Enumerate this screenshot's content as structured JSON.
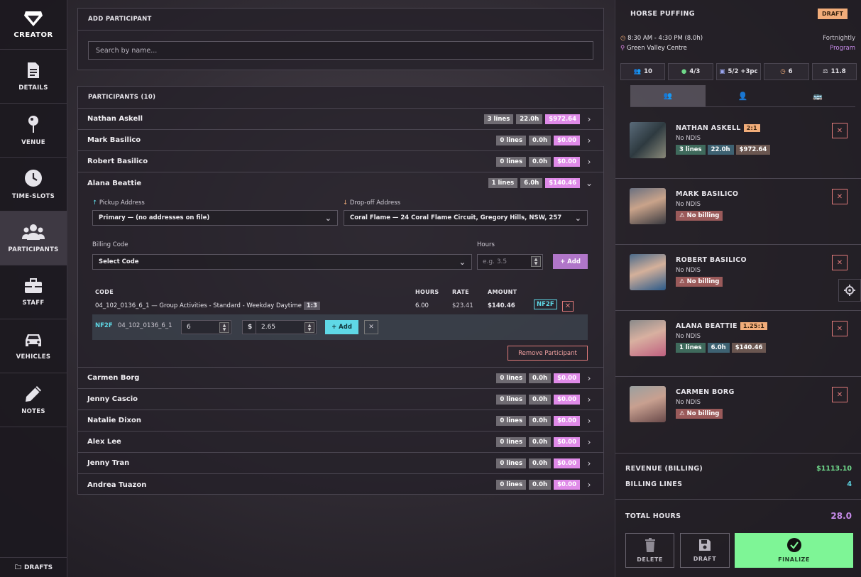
{
  "sidebar": {
    "brand": "CREATOR",
    "items": [
      {
        "label": "DETAILS",
        "icon": "document-icon"
      },
      {
        "label": "VENUE",
        "icon": "map-pin-icon"
      },
      {
        "label": "TIME-SLOTS",
        "icon": "clock-icon"
      },
      {
        "label": "PARTICIPANTS",
        "icon": "people-icon",
        "active": true
      },
      {
        "label": "STAFF",
        "icon": "briefcase-icon"
      },
      {
        "label": "VEHICLES",
        "icon": "car-icon"
      },
      {
        "label": "NOTES",
        "icon": "pencil-icon"
      }
    ],
    "drafts": "DRAFTS"
  },
  "add_participant": {
    "title": "ADD PARTICIPANT",
    "search_placeholder": "Search by name..."
  },
  "participants": {
    "title": "PARTICIPANTS (10)",
    "rows": [
      {
        "name": "Nathan Askell",
        "lines": "3 lines",
        "hours": "22.0h",
        "amount": "$972.64"
      },
      {
        "name": "Mark Basilico",
        "lines": "0 lines",
        "hours": "0.0h",
        "amount": "$0.00"
      },
      {
        "name": "Robert Basilico",
        "lines": "0 lines",
        "hours": "0.0h",
        "amount": "$0.00"
      },
      {
        "name": "Alana Beattie",
        "lines": "1 lines",
        "hours": "6.0h",
        "amount": "$140.46"
      },
      {
        "name": "Carmen Borg",
        "lines": "0 lines",
        "hours": "0.0h",
        "amount": "$0.00"
      },
      {
        "name": "Jenny Cascio",
        "lines": "0 lines",
        "hours": "0.0h",
        "amount": "$0.00"
      },
      {
        "name": "Natalie Dixon",
        "lines": "0 lines",
        "hours": "0.0h",
        "amount": "$0.00"
      },
      {
        "name": "Alex Lee",
        "lines": "0 lines",
        "hours": "0.0h",
        "amount": "$0.00"
      },
      {
        "name": "Jenny Tran",
        "lines": "0 lines",
        "hours": "0.0h",
        "amount": "$0.00"
      },
      {
        "name": "Andrea Tuazon",
        "lines": "0 lines",
        "hours": "0.0h",
        "amount": "$0.00"
      }
    ],
    "expanded": {
      "pickup_label": "Pickup Address",
      "pickup_value": "Primary — (no addresses on file)",
      "dropoff_label": "Drop-off Address",
      "dropoff_value": "Coral Flame — 24 Coral Flame Circuit, Gregory Hills, NSW, 257",
      "billing_label": "Billing Code",
      "billing_value": "Select Code",
      "hours_label": "Hours",
      "hours_placeholder": "e.g. 3.5",
      "add_label": "+ Add",
      "table_headers": {
        "code": "CODE",
        "hours": "HOURS",
        "rate": "RATE",
        "amount": "AMOUNT"
      },
      "line": {
        "code": "04_102_0136_6_1 — Group Activities - Standard - Weekday Daytime",
        "ratio": "1:3",
        "hours": "6.00",
        "rate": "$23.41",
        "amount": "$140.46",
        "flag": "NF2F"
      },
      "subline": {
        "flag": "NF2F",
        "code": "04_102_0136_6_1",
        "qty": "6",
        "currency": "$",
        "price": "2.65",
        "add_label": "+ Add"
      },
      "remove_label": "Remove Participant"
    }
  },
  "activity": {
    "title": "HORSE PUFFING",
    "status": "DRAFT",
    "time": "8:30 AM - 4:30 PM (8.0h)",
    "location": "Green Valley Centre",
    "frequency": "Fortnightly",
    "type": "Program",
    "stats": [
      {
        "icon": "people-icon",
        "value": "10",
        "color": "#c58ae8"
      },
      {
        "icon": "person-icon",
        "value": "4/3",
        "color": "#6fd88a"
      },
      {
        "icon": "bus-icon",
        "value": "5/2 +3pc",
        "color": "#9aa6f0"
      },
      {
        "icon": "clock-icon",
        "value": "6",
        "color": "#f2ad7a"
      },
      {
        "icon": "scale-icon",
        "value": "11.8",
        "color": "#e6e4ea"
      }
    ]
  },
  "cards": [
    {
      "name": "NATHAN ASKELL",
      "ratio": "2:1",
      "ndis": "No NDIS",
      "chips": [
        {
          "t": "3 lines",
          "k": "green"
        },
        {
          "t": "22.0h",
          "k": "blue"
        },
        {
          "t": "$972.64",
          "k": "brown"
        }
      ]
    },
    {
      "name": "MARK BASILICO",
      "ratio": "",
      "ndis": "No NDIS",
      "chips": [
        {
          "t": "No billing",
          "k": "red"
        }
      ]
    },
    {
      "name": "ROBERT BASILICO",
      "ratio": "",
      "ndis": "No NDIS",
      "chips": [
        {
          "t": "No billing",
          "k": "red"
        }
      ]
    },
    {
      "name": "ALANA BEATTIE",
      "ratio": "1.25:1",
      "ndis": "No NDIS",
      "chips": [
        {
          "t": "1 lines",
          "k": "green"
        },
        {
          "t": "6.0h",
          "k": "blue"
        },
        {
          "t": "$140.46",
          "k": "brown"
        }
      ]
    },
    {
      "name": "CARMEN BORG",
      "ratio": "",
      "ndis": "No NDIS",
      "chips": [
        {
          "t": "No billing",
          "k": "red"
        }
      ]
    }
  ],
  "summary": {
    "revenue_label": "REVENUE (BILLING)",
    "revenue_value": "$1113.10",
    "lines_label": "BILLING LINES",
    "lines_value": "4",
    "hours_label": "TOTAL HOURS",
    "hours_value": "28.0"
  },
  "actions": {
    "delete": "DELETE",
    "draft": "DRAFT",
    "finalize": "FINALIZE"
  },
  "colors": {
    "accent_pink": "#df8ae8",
    "accent_cyan": "#5fd8e6",
    "finalize_green": "#7ef596",
    "draft_orange": "#f2ad7a"
  }
}
